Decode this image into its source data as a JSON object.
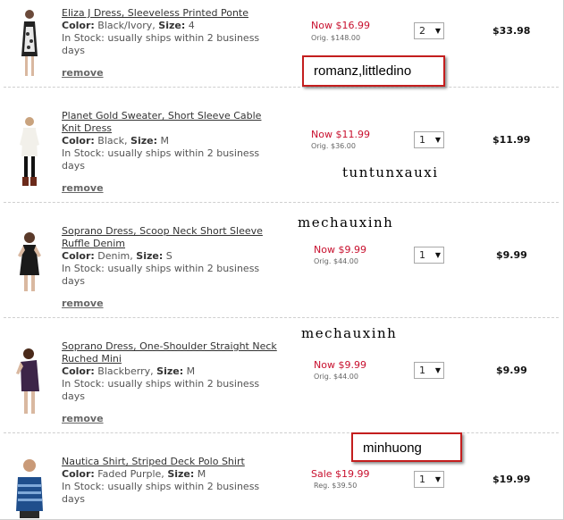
{
  "items": [
    {
      "title": "Eliza J Dress, Sleeveless Printed Ponte",
      "color_label": "Color:",
      "color": "Black/Ivory,",
      "size_label": "Size:",
      "size": "4",
      "stock": "In Stock: usually ships within 2 business days",
      "remove": "remove",
      "price_now": "Now $16.99",
      "price_orig": "Orig. $148.00",
      "qty": "2",
      "total": "$33.98"
    },
    {
      "title": "Planet Gold Sweater, Short Sleeve Cable Knit Dress",
      "color_label": "Color:",
      "color": "Black,",
      "size_label": "Size:",
      "size": "M",
      "stock": "In Stock: usually ships within 2 business days",
      "remove": "remove",
      "price_now": "Now $11.99",
      "price_orig": "Orig. $36.00",
      "qty": "1",
      "total": "$11.99"
    },
    {
      "title": "Soprano Dress, Scoop Neck Short Sleeve Ruffle Denim",
      "color_label": "Color:",
      "color": "Denim,",
      "size_label": "Size:",
      "size": "S",
      "stock": "In Stock: usually ships within 2 business days",
      "remove": "remove",
      "price_now": "Now $9.99",
      "price_orig": "Orig. $44.00",
      "qty": "1",
      "total": "$9.99"
    },
    {
      "title": "Soprano Dress, One-Shoulder Straight Neck Ruched Mini",
      "color_label": "Color:",
      "color": "Blackberry,",
      "size_label": "Size:",
      "size": "M",
      "stock": "In Stock: usually ships within 2 business days",
      "remove": "remove",
      "price_now": "Now $9.99",
      "price_orig": "Orig. $44.00",
      "qty": "1",
      "total": "$9.99"
    },
    {
      "title": "Nautica Shirt, Striped Deck Polo Shirt",
      "color_label": "Color:",
      "color": "Faded Purple,",
      "size_label": "Size:",
      "size": "M",
      "stock": "In Stock: usually ships within 2 business days",
      "price_now": "Sale $19.99",
      "price_orig": "Reg. $39.50",
      "qty": "1",
      "total": "$19.99"
    }
  ],
  "overlays": {
    "tag1": "romanz,littledino",
    "tag2": "tuntunxauxi",
    "tag3": "mechauxinh",
    "tag4": "mechauxinh",
    "tag5": "minhuong"
  },
  "colors": {
    "price_red": "#c8102e",
    "tag_border": "#c41e1e"
  }
}
